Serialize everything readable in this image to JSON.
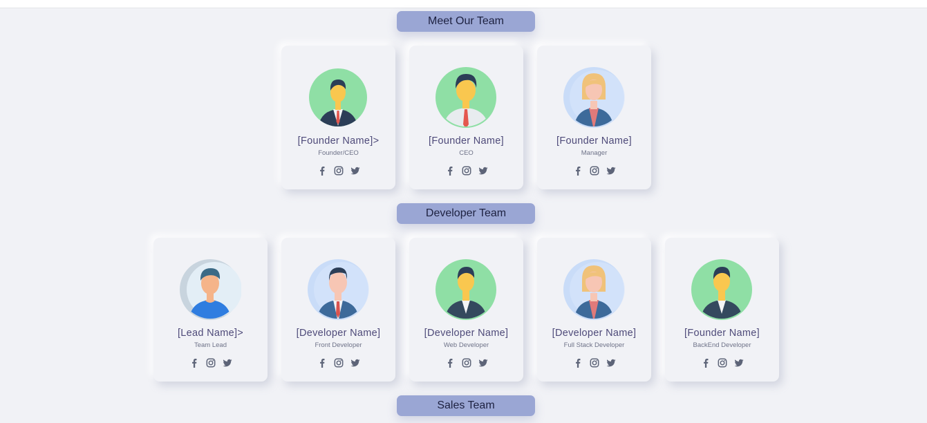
{
  "sections": [
    {
      "title": "Meet Our Team",
      "members": [
        {
          "name": "[Founder Name]>",
          "role": "Founder/CEO",
          "avatar": "man-suit-red-tie-green"
        },
        {
          "name": "[Founder Name]",
          "role": "CEO",
          "avatar": "man-shirt-red-tie-green"
        },
        {
          "name": "[Founder Name]",
          "role": "Manager",
          "avatar": "woman-blonde-blue"
        }
      ]
    },
    {
      "title": "Developer Team",
      "members": [
        {
          "name": "[Lead Name]>",
          "role": "Team Lead",
          "avatar": "man-casual-blue"
        },
        {
          "name": "[Developer Name]",
          "role": "Front Developer",
          "avatar": "man-suit-red-tie-blue"
        },
        {
          "name": "[Developer Name]",
          "role": "Web Developer",
          "avatar": "man-dark-suit-green"
        },
        {
          "name": "[Developer Name]",
          "role": "Full Stack Developer",
          "avatar": "woman-blonde-blue"
        },
        {
          "name": "[Founder Name]",
          "role": "BackEnd Developer",
          "avatar": "man-dark-suit-green"
        }
      ]
    },
    {
      "title": "Sales Team",
      "members": []
    }
  ],
  "social_icons": [
    "facebook-icon",
    "instagram-icon",
    "twitter-icon"
  ],
  "colors": {
    "background": "#f1f2f6",
    "section_title_bg": "#9aa6d4",
    "name_text": "#4e4a79",
    "role_text": "#6e7288",
    "social_icon": "#5d6478",
    "avatar_green": "#8fdfa5",
    "avatar_blue": "#c9dcf8"
  }
}
